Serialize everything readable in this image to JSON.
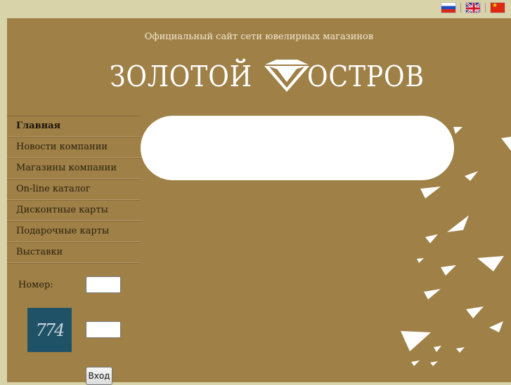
{
  "header": {
    "tagline": "Официальный сайт сети ювелирных магазинов",
    "logo_left": "ЗОЛОТОЙ",
    "logo_right": "ОСТРОВ"
  },
  "languages": [
    {
      "name": "flag-ru-icon"
    },
    {
      "name": "flag-uk-icon"
    },
    {
      "name": "flag-cn-icon"
    }
  ],
  "menu": {
    "items": [
      {
        "label": "Главная",
        "active": true
      },
      {
        "label": "Новости компании"
      },
      {
        "label": "Магазины компании"
      },
      {
        "label": "On-line каталог"
      },
      {
        "label": "Дисконтные карты"
      },
      {
        "label": "Подарочные карты"
      },
      {
        "label": "Выставки"
      }
    ]
  },
  "login": {
    "number_label": "Номер:",
    "captcha_text": "774",
    "submit_label": "Вход"
  },
  "colors": {
    "page_bg": "#d8d3a8",
    "main_bg": "#9f8047",
    "accent": "#ffffff"
  }
}
